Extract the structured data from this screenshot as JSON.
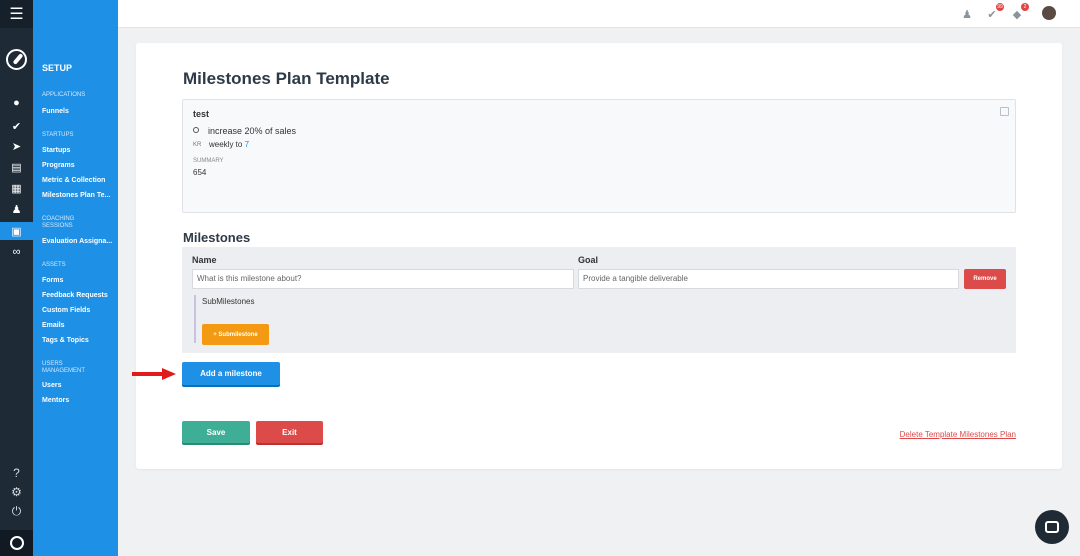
{
  "menu": {
    "title": "SETUP",
    "sections": [
      {
        "label": "APPLICATIONS",
        "items": [
          "Funnels"
        ]
      },
      {
        "label": "STARTUPS",
        "items": [
          "Startups",
          "Programs",
          "Metric & Collection",
          "Milestones Plan Te..."
        ]
      },
      {
        "label": "COACHING SESSIONS",
        "items": [
          "Evaluation Assigna..."
        ]
      },
      {
        "label": "ASSETS",
        "items": [
          "Forms",
          "Feedback Requests",
          "Custom Fields",
          "Emails",
          "Tags & Topics"
        ]
      },
      {
        "label": "USERS MANAGEMENT",
        "items": [
          "Users",
          "Mentors"
        ]
      }
    ]
  },
  "topbar": {
    "icons": [
      "users-icon",
      "tasks-icon",
      "bell-icon",
      "avatar"
    ],
    "badges": {
      "tasks": "99",
      "bell": "2"
    }
  },
  "page": {
    "title": "Milestones Plan Template",
    "summary": {
      "name": "test",
      "objective": "increase 20% of sales",
      "kr_tag": "KR",
      "kr_text": "weekly to ",
      "kr_value": "7",
      "summary_label": "SUMMARY",
      "summary_value": "654"
    },
    "milestones": {
      "title": "Milestones",
      "name_label": "Name",
      "goal_label": "Goal",
      "name_placeholder": "What is this milestone about?",
      "goal_placeholder": "Provide a tangible deliverable",
      "remove_label": "Remove",
      "sub_label": "SubMilestones",
      "add_sub_label": "+ Submilestone"
    },
    "add_milestone_label": "Add a milestone",
    "save_label": "Save",
    "exit_label": "Exit",
    "delete_label": "Delete Template Milestones Plan"
  },
  "colors": {
    "rail": "#1e2a36",
    "menu": "#1e90e6",
    "save": "#3fae96",
    "danger": "#dc4a4a",
    "warning": "#f39a12"
  }
}
